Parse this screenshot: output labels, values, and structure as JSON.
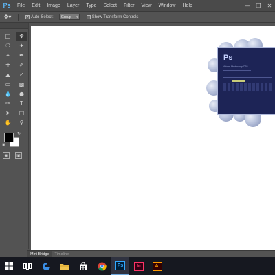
{
  "app": {
    "logo": "Ps"
  },
  "menu": [
    "File",
    "Edit",
    "Image",
    "Layer",
    "Type",
    "Select",
    "Filter",
    "View",
    "Window",
    "Help"
  ],
  "window_controls": [
    "minimize-icon",
    "restore-icon",
    "close-icon"
  ],
  "options": {
    "auto_select_label": "Auto-Select:",
    "auto_select_checked": true,
    "group_value": "Group",
    "show_transform_label": "Show Transform Controls",
    "show_transform_checked": false
  },
  "tools": [
    "move-tool-icon",
    "artboard-tool-icon",
    "marquee-tool-icon",
    "magic-wand-icon",
    "lasso-tool-icon",
    "eyedropper-icon",
    "crop-tool-icon",
    "slice-tool-icon",
    "healing-brush-icon",
    "brush-tool-icon",
    "clone-stamp-icon",
    "history-brush-icon",
    "eraser-tool-icon",
    "gradient-tool-icon",
    "blur-tool-icon",
    "dodge-tool-icon",
    "pen-tool-icon",
    "type-tool-icon",
    "path-selection-icon",
    "rectangle-tool-icon",
    "hand-tool-icon",
    "zoom-tool-icon"
  ],
  "colors": {
    "foreground": "#000000",
    "background": "#ffffff",
    "accent": "#5db6f4"
  },
  "splash": {
    "title": "Ps",
    "subtitle": "Adobe Photoshop CS6"
  },
  "bottom_tabs": [
    {
      "label": "Mini Bridge",
      "active": true
    },
    {
      "label": "Timeline",
      "active": false
    }
  ],
  "taskbar": {
    "items": [
      "windows-start-icon",
      "task-view-icon",
      "edge-browser-icon",
      "file-explorer-icon",
      "store-icon",
      "chrome-icon"
    ],
    "apps": [
      {
        "label": "Ps",
        "color": "#31a8ff",
        "bg": "#001e36",
        "active": true
      },
      {
        "label": "Ic",
        "color": "#ff3366",
        "bg": "#330013",
        "active": false
      },
      {
        "label": "Ai",
        "color": "#ff9a00",
        "bg": "#330000",
        "active": false
      }
    ]
  }
}
